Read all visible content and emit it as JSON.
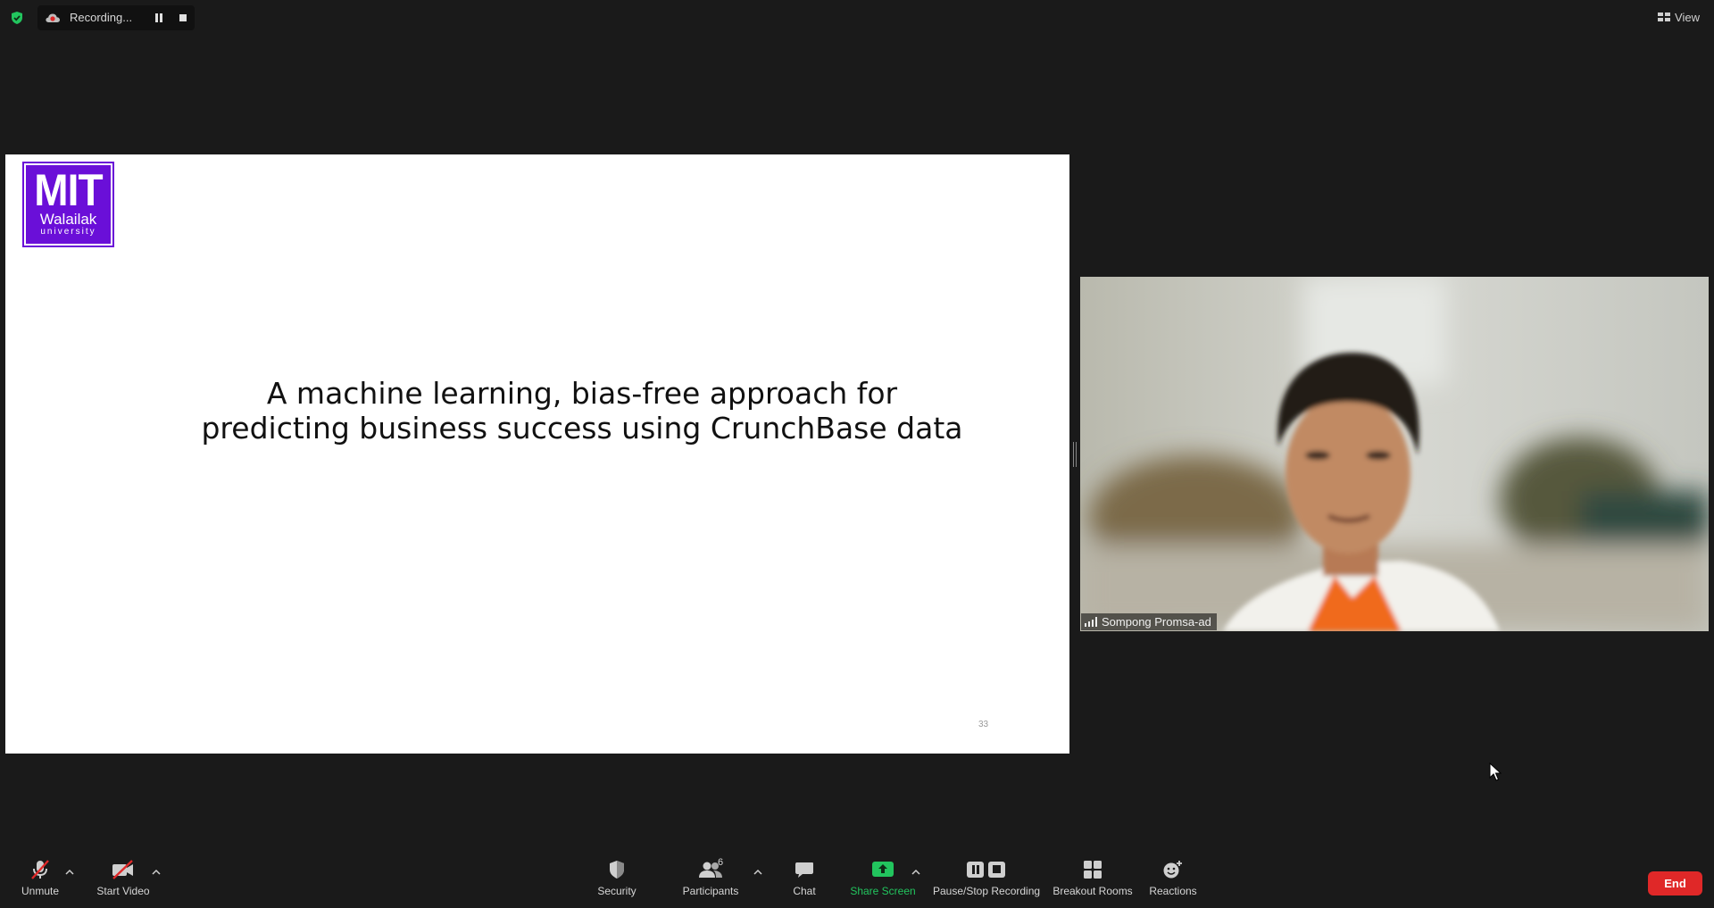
{
  "top_bar": {
    "recording_label": "Recording...",
    "view_label": "View"
  },
  "slide": {
    "logo_main": "MIT",
    "logo_sub": "Walailak",
    "logo_sub2": "university",
    "title_line1": "A machine learning, bias-free approach for",
    "title_line2": "predicting business success using CrunchBase data",
    "page_number": "33"
  },
  "video": {
    "participant_name": "Sompong Promsa-ad"
  },
  "toolbar": {
    "unmute": "Unmute",
    "start_video": "Start Video",
    "security": "Security",
    "participants": "Participants",
    "participants_count": "6",
    "chat": "Chat",
    "share_screen": "Share Screen",
    "pause_stop_recording": "Pause/Stop Recording",
    "breakout_rooms": "Breakout Rooms",
    "reactions": "Reactions",
    "end": "End"
  },
  "colors": {
    "background": "#1a1a1a",
    "share_green": "#22c55e",
    "end_red": "#e02828",
    "logo_purple": "#6a0fd8",
    "mute_red": "#e02828"
  }
}
